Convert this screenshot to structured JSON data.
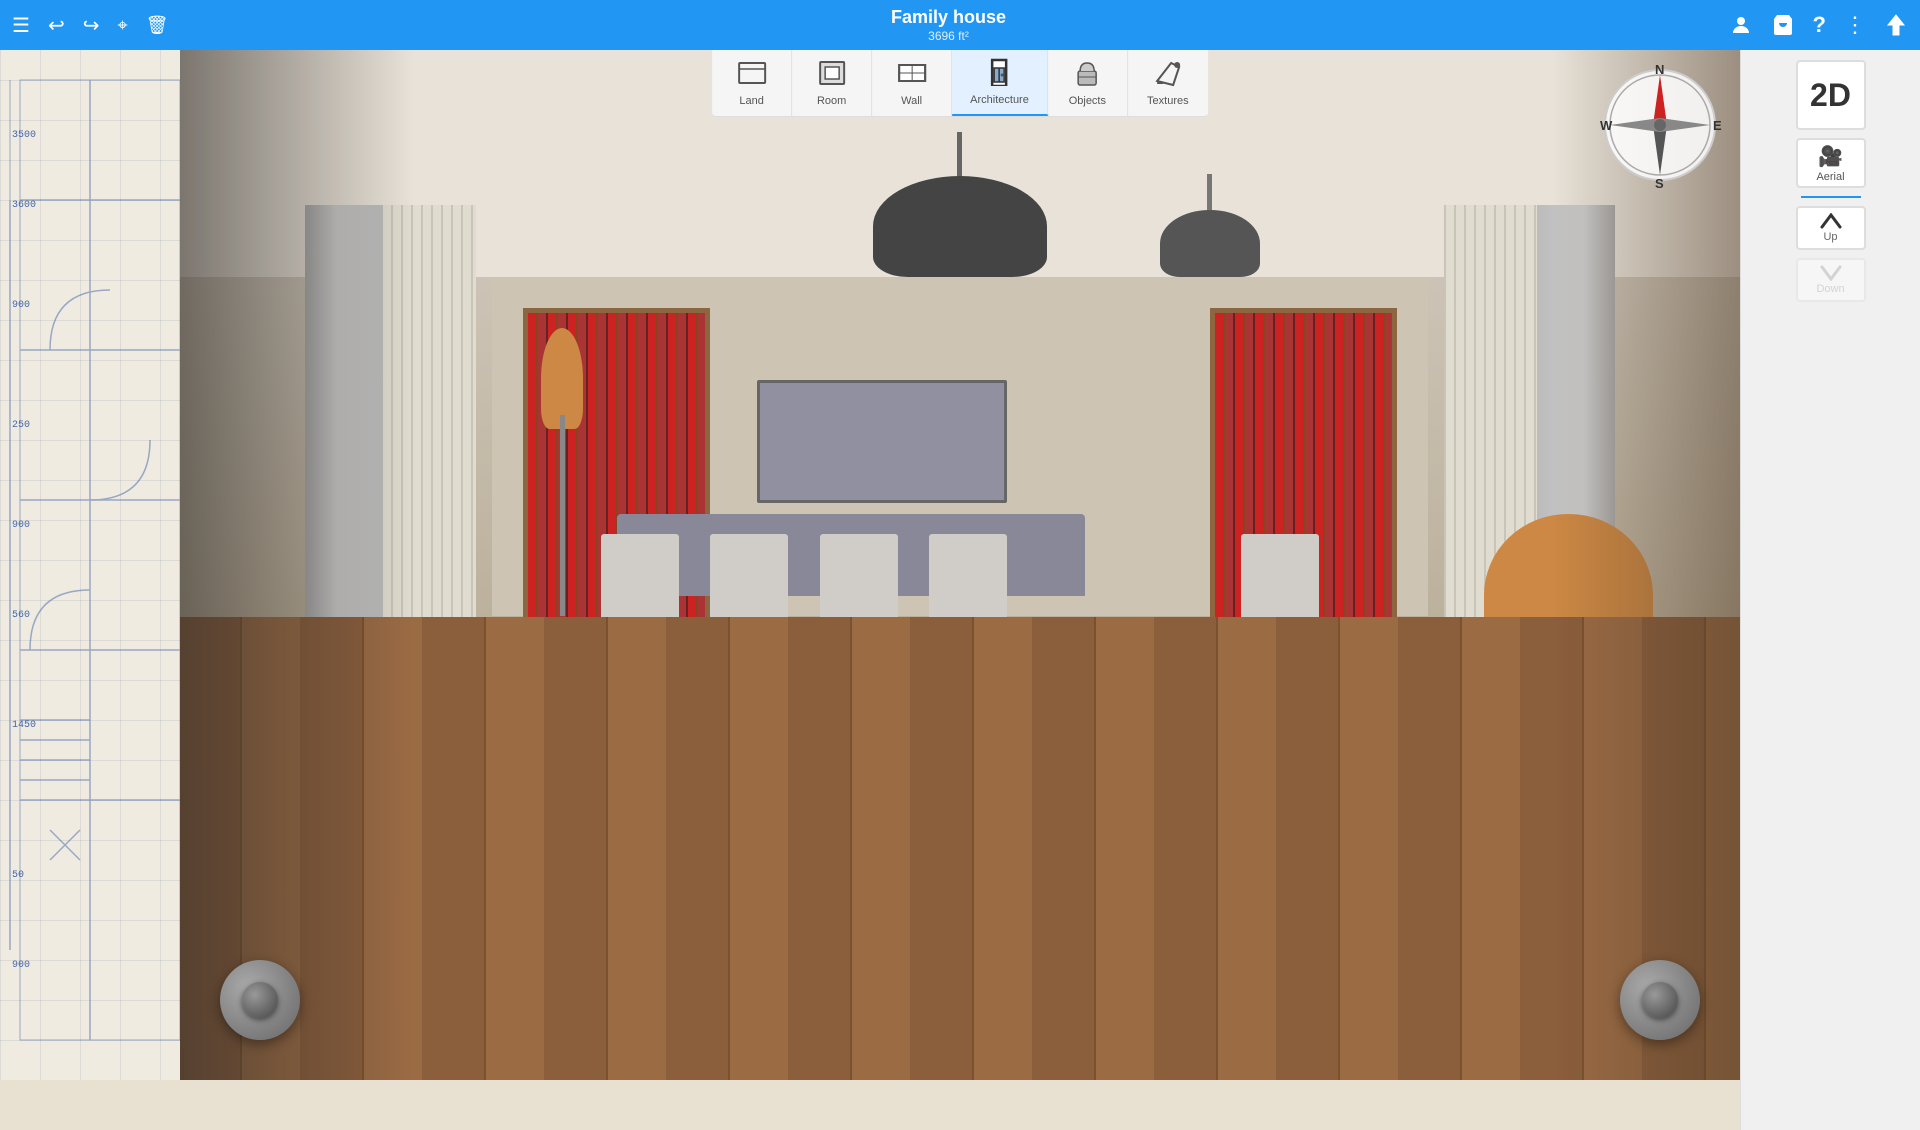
{
  "app": {
    "title": "Family house",
    "subtitle": "3696 ft²"
  },
  "toolbar": {
    "menu_label": "☰",
    "undo_label": "↩",
    "redo_label": "↪",
    "magnet_label": "⌖",
    "trash_label": "🗑",
    "account_label": "👤",
    "cart_label": "🛒",
    "help_label": "?",
    "more_label": "⋮",
    "upload_label": "▲"
  },
  "tools": [
    {
      "id": "land",
      "label": "Land",
      "icon": "⬜",
      "active": false
    },
    {
      "id": "room",
      "label": "Room",
      "icon": "⬛",
      "active": false
    },
    {
      "id": "wall",
      "label": "Wall",
      "icon": "▭",
      "active": false
    },
    {
      "id": "architecture",
      "label": "Architecture",
      "icon": "🚪",
      "active": true
    },
    {
      "id": "objects",
      "label": "Objects",
      "icon": "🪑",
      "active": false
    },
    {
      "id": "textures",
      "label": "Textures",
      "icon": "✏️",
      "active": false
    }
  ],
  "right_panel": {
    "view_2d_label": "2D",
    "aerial_label": "Aerial",
    "up_label": "Up",
    "down_label": "Down"
  },
  "compass": {
    "north": "N",
    "south": "S",
    "east": "E",
    "west": "W"
  },
  "blueprint_numbers": [
    "3500",
    "3600",
    "900",
    "250",
    "900",
    "560",
    "1450",
    "50",
    "900"
  ]
}
